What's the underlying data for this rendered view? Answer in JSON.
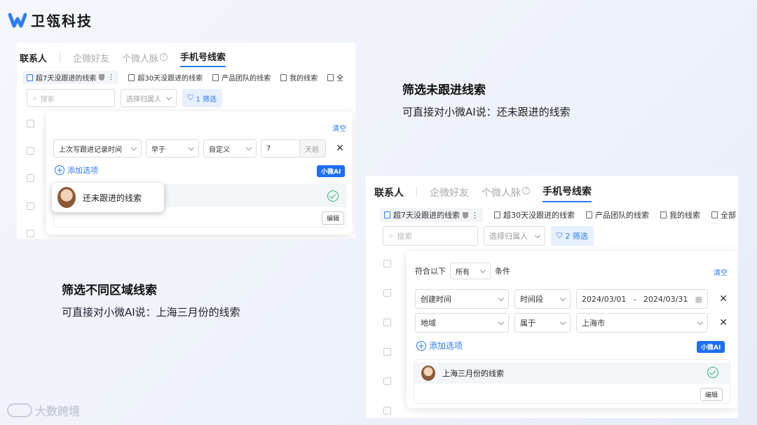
{
  "brand": {
    "name": "卫瓴科技"
  },
  "panel1": {
    "tabs": [
      "联系人",
      "企微好友",
      "个微人脉",
      "手机号线索"
    ],
    "views": [
      "超7天没跟进的线索",
      "超30天没跟进的线索",
      "产品团队的线索",
      "我的线索",
      "全"
    ],
    "search_placeholder": "搜索",
    "owner_select": "选择归属人",
    "filter_label": "1 筛选",
    "clear": "清空",
    "condition": {
      "field": "上次写跟进记录时间",
      "op": "早于",
      "mode": "自定义",
      "value": "7",
      "unit": "天前"
    },
    "add_option": "添加选项",
    "ai_badge": "小微AI",
    "ai_query": "还未跟进的线索",
    "edit": "编辑"
  },
  "panel2": {
    "tabs": [
      "联系人",
      "企微好友",
      "个微人脉",
      "手机号线索"
    ],
    "views": [
      "超7天没跟进的线索",
      "超30天没跟进的线索",
      "产品团队的线索",
      "我的线索",
      "全部"
    ],
    "search_placeholder": "搜索",
    "owner_select": "选择归属人",
    "filter_label": "2 筛选",
    "match_prefix": "符合以下",
    "match_value": "所有",
    "match_suffix": "条件",
    "clear": "清空",
    "condition1": {
      "field": "创建时间",
      "op": "时间段",
      "start": "2024/03/01",
      "dash": "-",
      "end": "2024/03/31"
    },
    "condition2": {
      "field": "地域",
      "op": "属于",
      "value": "上海市"
    },
    "add_option": "添加选项",
    "ai_badge": "小微AI",
    "ai_query": "上海三月份的线索",
    "edit": "编辑"
  },
  "captions": {
    "c1_title": "筛选未跟进线索",
    "c1_sub": "可直接对小微AI说：还未跟进的线索",
    "c2_title": "筛选不同区域线索",
    "c2_sub": "可直接对小微AI说：上海三月份的线索"
  },
  "watermark": "大数跨境",
  "colors": {
    "accent": "#2f7bf5",
    "ai_badge": "#1f6ef0",
    "success": "#2bb673"
  }
}
